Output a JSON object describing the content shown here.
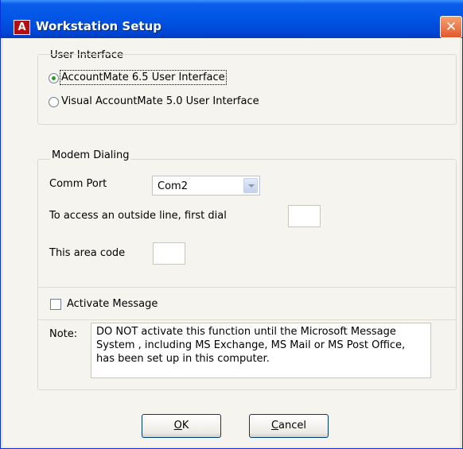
{
  "window": {
    "title": "Workstation Setup",
    "icon_letter": "A",
    "close_glyph": "✕"
  },
  "user_interface": {
    "group_label": "User Interface",
    "options": [
      {
        "label": "AccountMate 6.5 User Interface",
        "checked": true
      },
      {
        "label": "Visual AccountMate 5.0 User Interface",
        "checked": false
      }
    ]
  },
  "modem_dialing": {
    "group_label": "Modem Dialing",
    "comm_port_label": "Comm Port",
    "comm_port_value": "Com2",
    "outside_line_label": "To access an outside line, first dial",
    "outside_line_value": "",
    "area_code_label": "This area code",
    "area_code_value": ""
  },
  "message": {
    "activate_label": "Activate Message",
    "activate_checked": false,
    "note_label": "Note:",
    "note_text": "DO NOT activate this function until the Microsoft Message System , including MS Exchange, MS Mail or MS Post Office, has been set up in this computer."
  },
  "buttons": {
    "ok_mnemonic": "O",
    "ok_rest": "K",
    "cancel_mnemonic": "C",
    "cancel_rest": "ancel"
  }
}
